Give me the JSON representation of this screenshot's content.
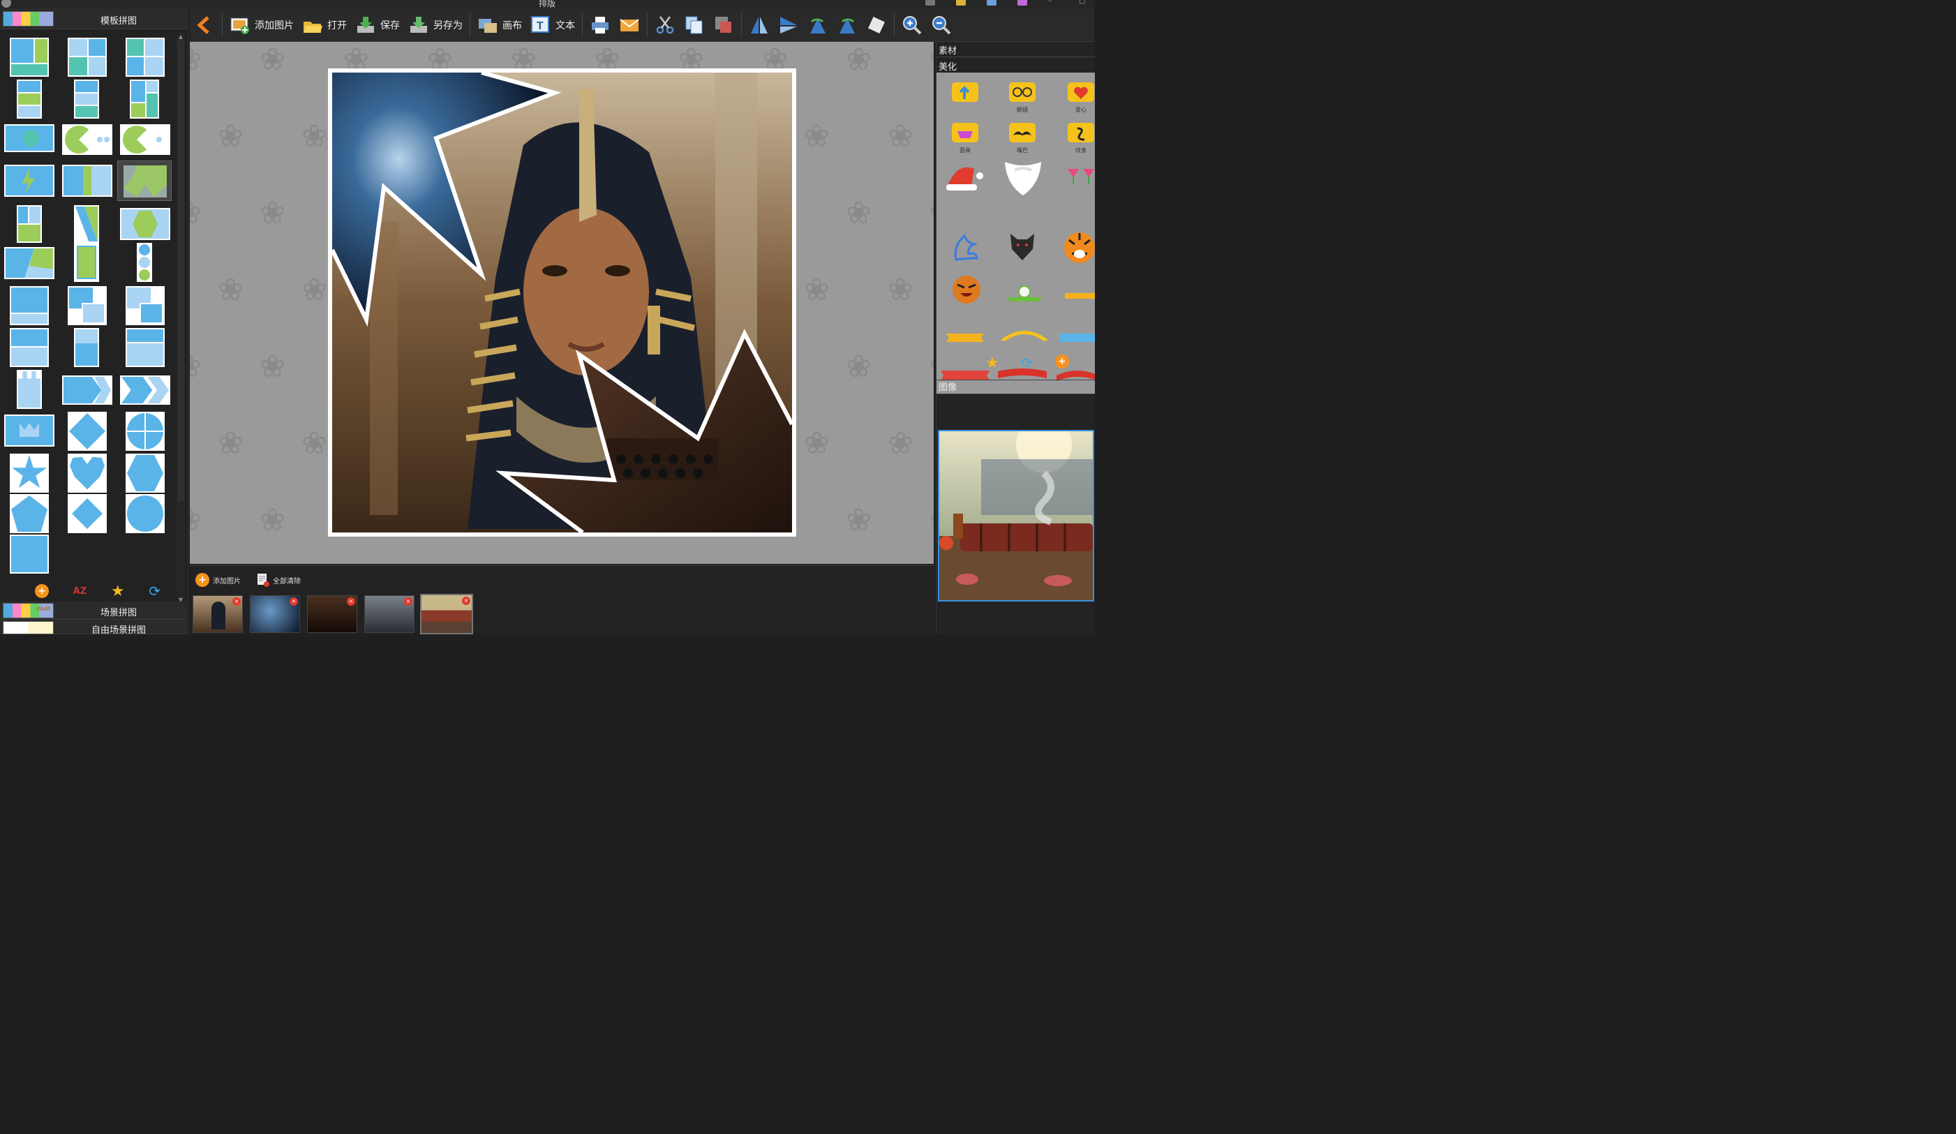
{
  "window": {
    "title": "排版"
  },
  "left_panel": {
    "category_top": "模板拼图",
    "category_scene": "场景拼图",
    "category_free_scene": "自由场景拼图",
    "scene_thumb_text": "iNxM",
    "az_label": "AZ"
  },
  "toolbar": {
    "add_image": "添加图片",
    "open": "打开",
    "save": "保存",
    "save_as": "另存为",
    "canvas": "画布",
    "text": "文本",
    "text_icon_glyph": "T"
  },
  "right_panel": {
    "material": "素材",
    "beautify": "美化",
    "image": "图像",
    "sticker_captions": [
      "眼镜",
      "爱心",
      "面具",
      "嘴巴",
      "纹身"
    ]
  },
  "bottom_strip": {
    "add_image": "添加图片",
    "clear_all": "全部清除",
    "remove_glyph": "×"
  },
  "colors": {
    "accent_orange": "#f7931e",
    "selection_blue": "#3a8fd8",
    "template_blue": "#5ab4e8"
  }
}
